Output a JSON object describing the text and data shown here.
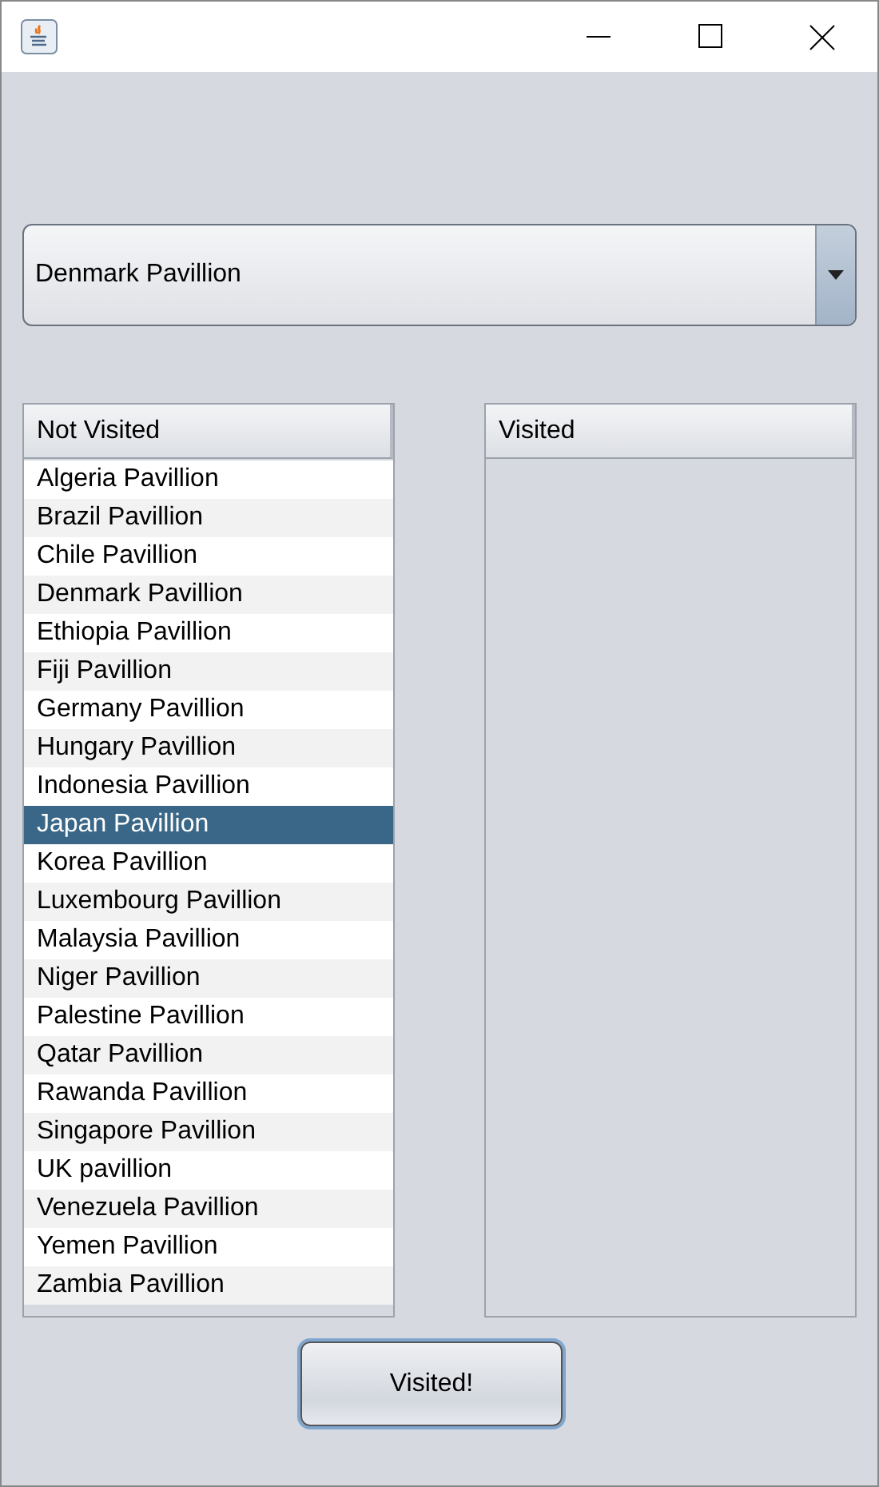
{
  "combo": {
    "value": "Denmark Pavillion"
  },
  "lists": [
    {
      "header": "Not Visited",
      "items": [
        {
          "label": "Algeria Pavillion",
          "selected": false
        },
        {
          "label": "Brazil Pavillion",
          "selected": false
        },
        {
          "label": "Chile Pavillion",
          "selected": false
        },
        {
          "label": "Denmark Pavillion",
          "selected": false
        },
        {
          "label": "Ethiopia Pavillion",
          "selected": false
        },
        {
          "label": "Fiji Pavillion",
          "selected": false
        },
        {
          "label": "Germany Pavillion",
          "selected": false
        },
        {
          "label": "Hungary Pavillion",
          "selected": false
        },
        {
          "label": "Indonesia Pavillion",
          "selected": false
        },
        {
          "label": "Japan Pavillion",
          "selected": true
        },
        {
          "label": "Korea Pavillion",
          "selected": false
        },
        {
          "label": "Luxembourg Pavillion",
          "selected": false
        },
        {
          "label": "Malaysia Pavillion",
          "selected": false
        },
        {
          "label": "Niger Pavillion",
          "selected": false
        },
        {
          "label": "Palestine Pavillion",
          "selected": false
        },
        {
          "label": "Qatar Pavillion",
          "selected": false
        },
        {
          "label": "Rawanda Pavillion",
          "selected": false
        },
        {
          "label": "Singapore Pavillion",
          "selected": false
        },
        {
          "label": "UK pavillion",
          "selected": false
        },
        {
          "label": "Venezuela Pavillion",
          "selected": false
        },
        {
          "label": "Yemen Pavillion",
          "selected": false
        },
        {
          "label": "Zambia Pavillion",
          "selected": false
        }
      ]
    },
    {
      "header": "Visited"
    }
  ],
  "button": "Visited!"
}
